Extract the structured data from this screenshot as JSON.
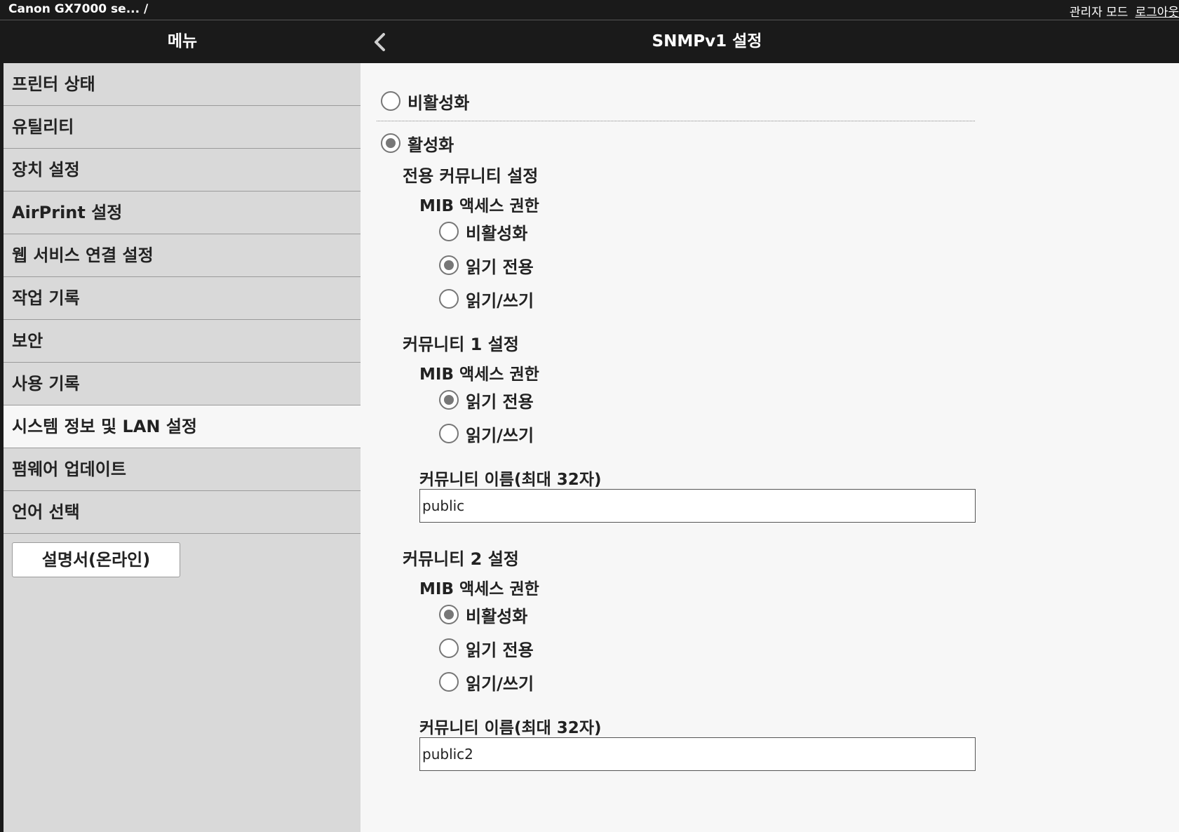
{
  "topbar": {
    "breadcrumb": "Canon GX7000 se... /",
    "admin_mode": "관리자 모드",
    "logout": "로그아웃"
  },
  "header": {
    "menu_title": "메뉴",
    "back_icon": "chevron-left-icon",
    "page_title": "SNMPv1 설정"
  },
  "sidebar": {
    "items": [
      {
        "label": "프린터 상태"
      },
      {
        "label": "유틸리티"
      },
      {
        "label": "장치 설정"
      },
      {
        "label": "AirPrint 설정"
      },
      {
        "label": "웹 서비스 연결 설정"
      },
      {
        "label": "작업 기록"
      },
      {
        "label": "보안"
      },
      {
        "label": "사용 기록"
      },
      {
        "label": "시스템 정보 및 LAN 설정",
        "active": true
      },
      {
        "label": "펌웨어 업데이트"
      },
      {
        "label": "언어 선택"
      }
    ],
    "manual_button": "설명서(온라인)"
  },
  "snmp": {
    "disable_label": "비활성화",
    "enable_label": "활성화",
    "selected": "enable",
    "dedicated": {
      "title": "전용 커뮤니티 설정",
      "mib_label": "MIB 액세스 권한",
      "options": [
        "비활성화",
        "읽기 전용",
        "읽기/쓰기"
      ],
      "selected": "읽기 전용"
    },
    "community1": {
      "title": "커뮤니티 1 설정",
      "mib_label": "MIB 액세스 권한",
      "options": [
        "읽기 전용",
        "읽기/쓰기"
      ],
      "selected": "읽기 전용",
      "name_label": "커뮤니티 이름(최대 32자)",
      "name_value": "public"
    },
    "community2": {
      "title": "커뮤니티 2 설정",
      "mib_label": "MIB 액세스 권한",
      "options": [
        "비활성화",
        "읽기 전용",
        "읽기/쓰기"
      ],
      "selected": "비활성화",
      "name_label": "커뮤니티 이름(최대 32자)",
      "name_value": "public2"
    }
  },
  "colors": {
    "header_bg": "#1a1a1a",
    "sidebar_bg": "#d9d9d9",
    "content_bg": "#f7f7f7"
  }
}
